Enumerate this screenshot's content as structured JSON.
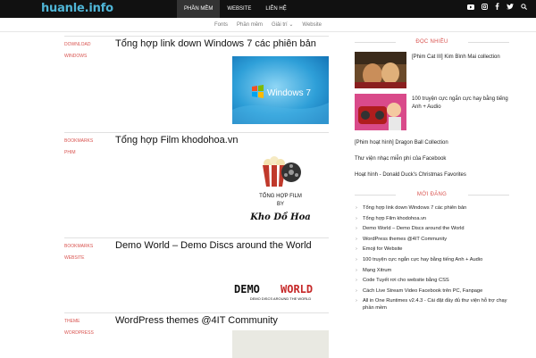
{
  "site": {
    "logo": "huanle.info",
    "top_nav": [
      {
        "label": "PHẦN MỀM"
      },
      {
        "label": "WEBSITE"
      },
      {
        "label": "LIÊN HỆ"
      }
    ],
    "social_icons": [
      "youtube-icon",
      "instagram-icon",
      "facebook-icon",
      "twitter-icon",
      "search-icon"
    ],
    "sub_nav": [
      {
        "label": "Fonts"
      },
      {
        "label": "Phần mềm"
      },
      {
        "label": "Giải trí ⌄"
      },
      {
        "label": "Website"
      }
    ]
  },
  "posts": [
    {
      "categories": [
        "DOWNLOAD",
        "WINDOWS"
      ],
      "title": "Tổng hợp link down Windows 7 các phiên bản",
      "thumb_text": "Windows 7"
    },
    {
      "categories": [
        "BOOKMARKS",
        "PHIM"
      ],
      "title": "Tổng hợp Film khodohoa.vn",
      "thumb_line1": "TỔNG HỢP FILM",
      "thumb_line2": "BY",
      "thumb_line3": "Kho Dồ Hoa"
    },
    {
      "categories": [
        "BOOKMARKS",
        "WEBSITE"
      ],
      "title": "Demo World – Demo Discs around the World",
      "thumb_demo": "DEMO",
      "thumb_world": "WORLD",
      "thumb_sub": "DEMO DISCS AROUND THE WORLD"
    },
    {
      "categories": [
        "THEME",
        "WORDPRESS"
      ],
      "title": "WordPress themes @4IT Community"
    }
  ],
  "sidebar": {
    "popular_heading": "ĐỌC NHIỀU",
    "popular_items": [
      {
        "title": "[Phim Cat III] Kim Bình Mai collection"
      },
      {
        "title": "100 truyện cực ngắn cực hay bằng tiếng Anh + Audio"
      }
    ],
    "popular_links": [
      "[Phim hoạt hình] Dragon Ball Collection",
      "Thư viện nhạc miễn phí của Facebook",
      "Hoạt hình - Donald Duck's Christmas Favorites"
    ],
    "recent_heading": "MỚI ĐĂNG",
    "recent_items": [
      "Tổng hợp link down Windows 7 các phiên bản",
      "Tổng hợp Film khodohoa.vn",
      "Demo World – Demo Discs around the World",
      "WordPress themes @4IT Community",
      "Emoji for Website",
      "100 truyện cực ngắn cực hay bằng tiếng Anh + Audio",
      "Mạng Xitrum",
      "Code Tuyết rơi cho website bằng CSS",
      "Cách Live Stream Video Facebook trên PC, Fanpage",
      "All in One Runtimes v2.4.3 - Cài đặt đầy đủ thư viện hỗ trợ chạy phần mềm"
    ]
  },
  "colors": {
    "accent": "#d9534f",
    "logo": "#4fb5d6",
    "topbar": "#111111"
  }
}
